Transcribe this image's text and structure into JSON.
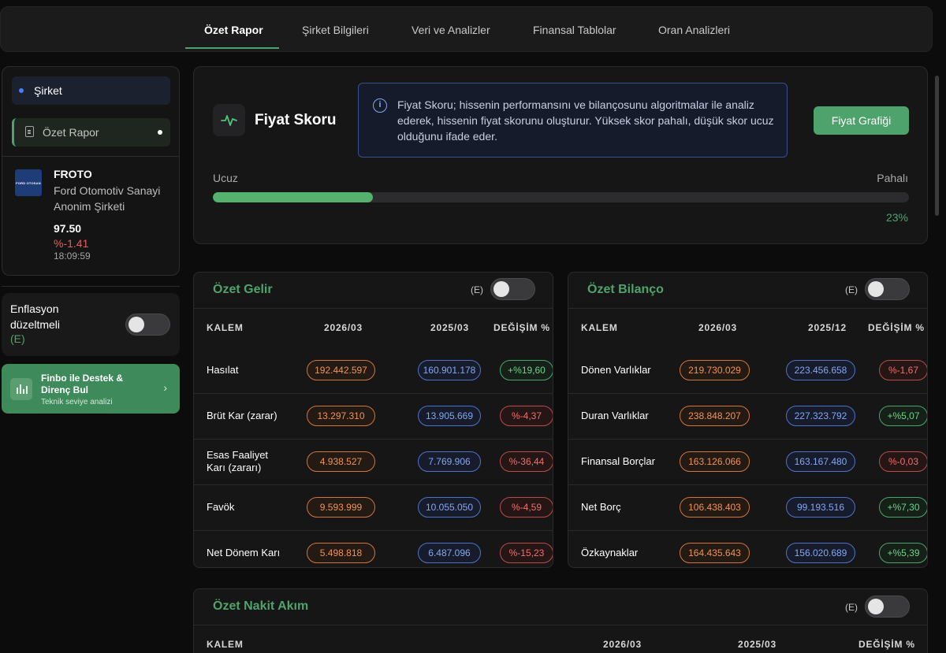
{
  "nav": {
    "tabs": [
      "Özet Rapor",
      "Şirket Bilgileri",
      "Veri ve Analizler",
      "Finansal Tablolar",
      "Oran Analizleri"
    ],
    "active": "Özet Rapor"
  },
  "sidebar": {
    "menu": [
      {
        "label": "Şirket"
      },
      {
        "label": "Özet Rapor"
      }
    ],
    "company": {
      "logo_text": "FORD OTOSAN",
      "ticker": "FROTO",
      "name": "Ford Otomotiv Sanayi Anonim Şirketi",
      "price": "97.50",
      "change": "%-1.41",
      "time": "18:09:59"
    },
    "inflation": {
      "label": "Enflasyon düzeltmeli",
      "suffix": "(E)",
      "enabled": false
    },
    "finbo": {
      "title": "Finbo ile Destek & Direnç Bul",
      "subtitle": "Teknik seviye analizi"
    }
  },
  "score": {
    "title": "Fiyat Skoru",
    "info": "Fiyat Skoru; hissenin performansını ve bilançosunu algoritmalar ile analiz ederek, hissenin fiyat skorunu oluşturur. Yüksek skor pahalı, düşük skor ucuz olduğunu ifade eder.",
    "button": "Fiyat Grafiği",
    "low_label": "Ucuz",
    "high_label": "Pahalı",
    "value": 23,
    "value_label": "23%"
  },
  "income": {
    "title": "Özet Gelir",
    "toggle_label": "(E)",
    "headers": [
      "KALEM",
      "2026/03",
      "2025/03",
      "DEĞİŞİM %"
    ],
    "rows": [
      {
        "label": "Hasılat",
        "v1": "192.442.597",
        "v2": "160.901.178",
        "chg": "+%19,60",
        "dir": "g"
      },
      {
        "label": "Brüt Kar (zarar)",
        "v1": "13.297.310",
        "v2": "13.905.669",
        "chg": "%-4,37",
        "dir": "r"
      },
      {
        "label": "Esas Faaliyet Karı (zararı)",
        "v1": "4.938.527",
        "v2": "7.769.906",
        "chg": "%-36,44",
        "dir": "r"
      },
      {
        "label": "Favök",
        "v1": "9.593.999",
        "v2": "10.055.050",
        "chg": "%-4,59",
        "dir": "r"
      },
      {
        "label": "Net Dönem Karı",
        "v1": "5.498.818",
        "v2": "6.487.096",
        "chg": "%-15,23",
        "dir": "r"
      }
    ]
  },
  "balance": {
    "title": "Özet Bilanço",
    "toggle_label": "(E)",
    "headers": [
      "KALEM",
      "2026/03",
      "2025/12",
      "DEĞİŞİM %"
    ],
    "rows": [
      {
        "label": "Dönen Varlıklar",
        "v1": "219.730.029",
        "v2": "223.456.658",
        "chg": "%-1,67",
        "dir": "r"
      },
      {
        "label": "Duran Varlıklar",
        "v1": "238.848.207",
        "v2": "227.323.792",
        "chg": "+%5,07",
        "dir": "g"
      },
      {
        "label": "Finansal Borçlar",
        "v1": "163.126.066",
        "v2": "163.167.480",
        "chg": "%-0,03",
        "dir": "r"
      },
      {
        "label": "Net Borç",
        "v1": "106.438.403",
        "v2": "99.193.516",
        "chg": "+%7,30",
        "dir": "g"
      },
      {
        "label": "Özkaynaklar",
        "v1": "164.435.643",
        "v2": "156.020.689",
        "chg": "+%5,39",
        "dir": "g"
      }
    ]
  },
  "cashflow": {
    "title": "Özet Nakit Akım",
    "toggle_label": "(E)",
    "headers": [
      "KALEM",
      "2026/03",
      "2025/03",
      "DEĞİŞİM %"
    ]
  }
}
